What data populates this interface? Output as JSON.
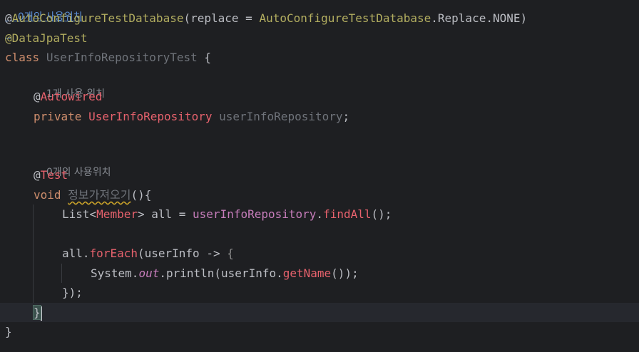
{
  "inlay_hints": {
    "top_usages": "0개의 사용위치",
    "field_usages": "1개 사용 위치",
    "method_usages": "0개의 사용위치"
  },
  "code": {
    "ann1_at": "@",
    "ann1_name": "AutoConfigureTestDatabase",
    "ann1_open": "(replace = ",
    "ann1_value_class": "AutoConfigureTestDatabase",
    "ann1_value_rest": ".Replace.NONE)",
    "ann2": "@DataJpaTest",
    "class_kw": "class",
    "class_name": "UserInfoRepositoryTest",
    "class_open": " {",
    "field_ann_at": "@",
    "field_ann_name": "Autowired",
    "field_private": "private",
    "field_type": "UserInfoRepository",
    "field_name": "userInfoRepository",
    "field_semi": ";",
    "test_ann_at": "@",
    "test_ann_name": "Test",
    "method_void": "void",
    "method_name": "정보가져오기",
    "method_parens": "()",
    "method_open": "{",
    "list_type": "List<",
    "list_generic": "Member",
    "list_close": "> all = ",
    "repo_ref": "userInfoRepository",
    "dot1": ".",
    "find_all": "findAll",
    "find_all_tail": "();",
    "all_ref": "all",
    "dot2": ".",
    "for_each": "forEach",
    "for_each_open": "(userInfo -> ",
    "lambda_brace": "{",
    "system": "System.",
    "out": "out",
    "println_open": ".println(userInfo.",
    "get_name": "getName",
    "println_close": "());",
    "lambda_close": "});",
    "method_close": "}",
    "class_close": "}"
  }
}
